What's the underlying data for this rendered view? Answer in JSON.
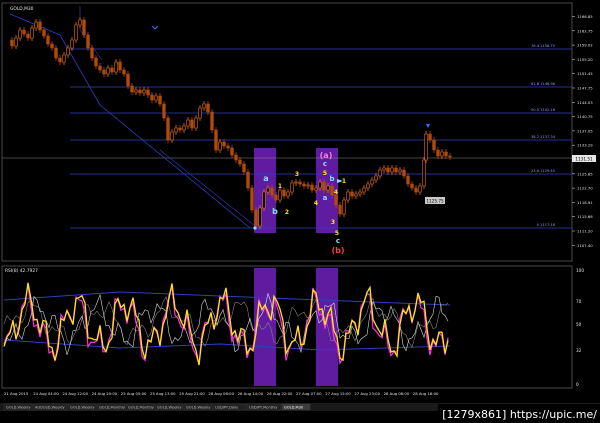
{
  "window": {
    "symbol_label": "GOLD,M30",
    "watermark": "[1279x861] https://upic.me/"
  },
  "colors": {
    "background": "#000000",
    "candle": "#e46d1a",
    "candle_dark": "#b24a0a",
    "fib_line": "#2f3fbf",
    "highlight_band": "#6a1fb3",
    "rsi_line": "#ffe21c",
    "rsi_magenta": "#ff2ee6",
    "axis_text": "#e6e6e6",
    "wave_yellow": "#ffe21c",
    "wave_cyan": "#7fe3ff",
    "wave_red": "#ff3b3b",
    "wave_pink": "#ff7bd8",
    "price_tag_bg": "#c9c9c9"
  },
  "fib_labels": [
    "76.4 1158.75",
    "61.8 1146.96",
    "50.0 1142.16",
    "38.2 1137.34",
    "23.6 1129.45",
    "0 1117.18"
  ],
  "price_axis": {
    "ticks": [
      "1166.85",
      "1162.75",
      "1159.02",
      "1155.20",
      "1151.45",
      "1147.75",
      "1144.03",
      "1140.75",
      "1137.05",
      "1133.29",
      "1129.55",
      "1125.85",
      "1122.70",
      "1118.91",
      "1115.66",
      "1111.20",
      "1107.40"
    ],
    "current_price": "1131.51",
    "marker_price": "1125.75"
  },
  "rsi": {
    "label": "RSI(8) 42.7927",
    "ticks": [
      "100",
      "70",
      "50",
      "32",
      "0"
    ]
  },
  "time_axis": {
    "ticks": [
      "21 Aug 2015",
      "24 Aug 04:00",
      "24 Aug 12:00",
      "24 Aug 20:00",
      "25 Aug 05:00",
      "25 Aug 13:00",
      "25 Aug 21:00",
      "26 Aug 06:00",
      "26 Aug 14:00",
      "26 Aug 22:00",
      "27 Aug 07:00",
      "27 Aug 15:00",
      "27 Aug 23:00",
      "28 Aug 08:00",
      "28 Aug 16:00"
    ]
  },
  "wave_labels": {
    "a_left": "a",
    "b_left": "b",
    "one_left": "1",
    "two_left": "2",
    "three_left": "3",
    "four_left": "4",
    "paren_a": "(a)",
    "c_top": "c",
    "a_mid": "a",
    "b_mid": "b",
    "five_mid": "5",
    "four_mid": "4",
    "one_mid": "1",
    "three_mid": "3",
    "five_low": "5",
    "c_low": "c",
    "paren_b": "(b)"
  },
  "tabs": [
    "GOLD,Weekly",
    "AUDUSD,Weekly",
    "GOLD,Weekly",
    "GOLD,Monthly",
    "GOLD,Monthly",
    "GOLD,Weekly",
    "GOLD,Weekly",
    "USDJPY,Daily",
    "USDJPY,Monthly",
    "GOLD,M30"
  ]
}
